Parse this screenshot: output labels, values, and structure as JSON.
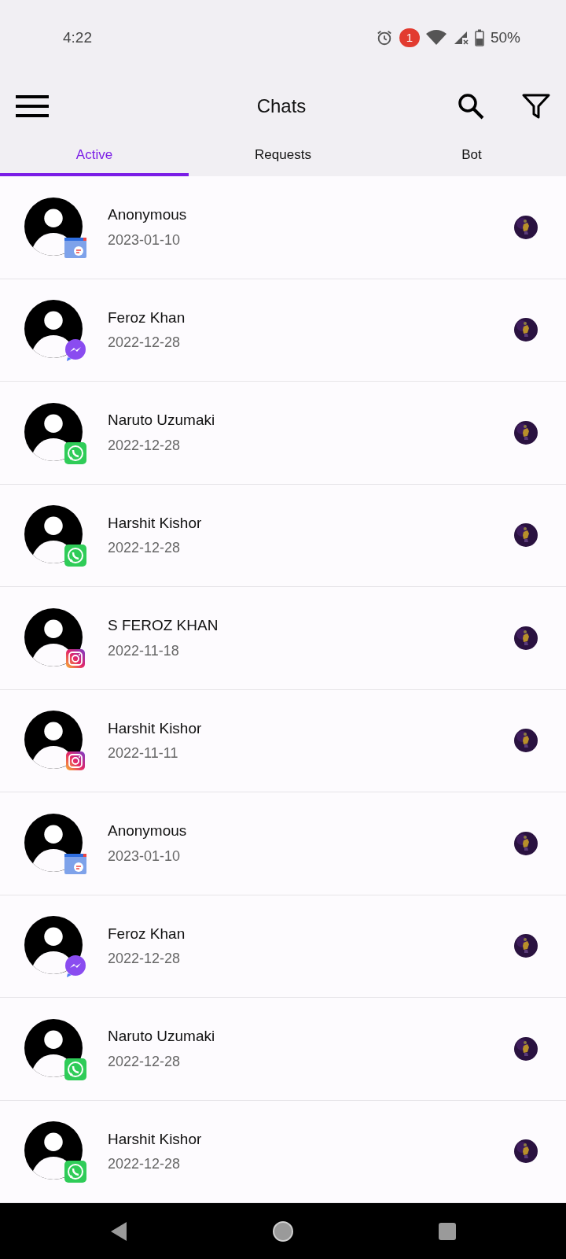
{
  "status_bar": {
    "time": "4:22",
    "notification_count": "1",
    "battery": "50%"
  },
  "app_bar": {
    "title": "Chats"
  },
  "tabs": [
    {
      "label": "Active",
      "selected": true
    },
    {
      "label": "Requests",
      "selected": false
    },
    {
      "label": "Bot",
      "selected": false
    }
  ],
  "chats": [
    {
      "name": "Anonymous",
      "date": "2023-01-10",
      "kind": "webchat"
    },
    {
      "name": "Feroz Khan",
      "date": "2022-12-28",
      "kind": "messenger"
    },
    {
      "name": "Naruto Uzumaki",
      "date": "2022-12-28",
      "kind": "whatsapp"
    },
    {
      "name": "Harshit Kishor",
      "date": "2022-12-28",
      "kind": "whatsapp"
    },
    {
      "name": "S FEROZ KHAN",
      "date": "2022-11-18",
      "kind": "instagram"
    },
    {
      "name": "Harshit Kishor",
      "date": "2022-11-11",
      "kind": "instagram"
    },
    {
      "name": "Anonymous",
      "date": "2023-01-10",
      "kind": "webchat"
    },
    {
      "name": "Feroz Khan",
      "date": "2022-12-28",
      "kind": "messenger"
    },
    {
      "name": "Naruto Uzumaki",
      "date": "2022-12-28",
      "kind": "whatsapp"
    },
    {
      "name": "Harshit Kishor",
      "date": "2022-12-28",
      "kind": "whatsapp"
    }
  ]
}
